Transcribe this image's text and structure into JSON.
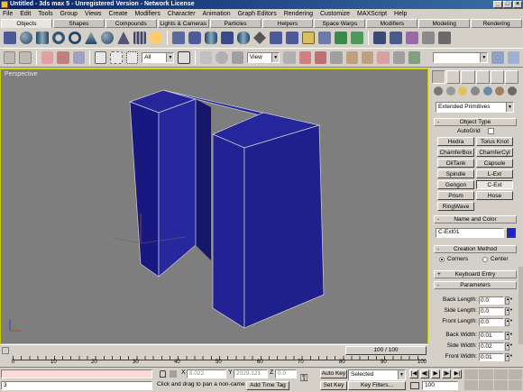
{
  "window": {
    "title": "Untitled - 3ds max 5 - Unregistered Version - Network License"
  },
  "menu": [
    "File",
    "Edit",
    "Tools",
    "Group",
    "Views",
    "Create",
    "Modifiers",
    "Character",
    "Animation",
    "Graph Editors",
    "Rendering",
    "Customize",
    "MAXScript",
    "Help"
  ],
  "tabs": [
    {
      "label": "Objects",
      "active": true
    },
    {
      "label": "Shapes"
    },
    {
      "label": "Compounds"
    },
    {
      "label": "Lights & Cameras"
    },
    {
      "label": "Particles"
    },
    {
      "label": "Helpers"
    },
    {
      "label": "Space Warps"
    },
    {
      "label": "Modifiers"
    },
    {
      "label": "Modeling"
    },
    {
      "label": "Rendering"
    }
  ],
  "toolbar": {
    "selection_filter": "All",
    "ref_coord": "View"
  },
  "viewport": {
    "label": "Perspective",
    "object_color": "#202099",
    "background": "#7e7e7e"
  },
  "command_panel": {
    "category": "Extended Primitives",
    "object_type": {
      "header": "Object Type",
      "autogrid_label": "AutoGrid",
      "buttons": [
        [
          "Hedra",
          "Torus Knot"
        ],
        [
          "ChamferBox",
          "ChamferCyl"
        ],
        [
          "OilTank",
          "Capsule"
        ],
        [
          "Spindle",
          "L-Ext"
        ],
        [
          "Gengon",
          "C-Ext"
        ],
        [
          "Prism",
          "Hose"
        ],
        [
          "RingWave",
          ""
        ]
      ]
    },
    "name_color": {
      "header": "Name and Color",
      "name": "C-Ext01",
      "color": "#2222cc"
    },
    "creation_method": {
      "header": "Creation Method",
      "options": [
        "Corners",
        "Center"
      ],
      "selected": "Corners"
    },
    "keyboard_entry": {
      "header": "Keyboard Entry",
      "sign": "+"
    },
    "parameters": {
      "header": "Parameters",
      "sign": "-",
      "fields": [
        {
          "label": "Back Length:",
          "value": "0.0"
        },
        {
          "label": "Side Length:",
          "value": "0.0"
        },
        {
          "label": "Front Length:",
          "value": "0.0"
        },
        {
          "label": "Back Width:",
          "value": "0.01"
        },
        {
          "label": "Side Width:",
          "value": "0.02"
        },
        {
          "label": "Front Width:",
          "value": "0.01"
        }
      ]
    }
  },
  "timeslider": {
    "label": "100 / 100",
    "value": 100,
    "max": 100
  },
  "trackbar": {
    "ticks": [
      "0",
      "10",
      "20",
      "30",
      "40",
      "50",
      "60",
      "70",
      "80",
      "90",
      "100"
    ]
  },
  "status": {
    "script_value": "3",
    "x_label": "X",
    "x_value": "8.022",
    "y_label": "Y",
    "y_value": "2029.121",
    "z_label": "Z",
    "z_value": "0.0",
    "prompt": "Click and drag to pan a non-camer.",
    "add_time_tag": "Add Time Tag",
    "auto_key": "Auto Key",
    "set_key": "Set Key",
    "selected": "Selected",
    "key_filters": "Key Filters...",
    "frame": "100"
  }
}
